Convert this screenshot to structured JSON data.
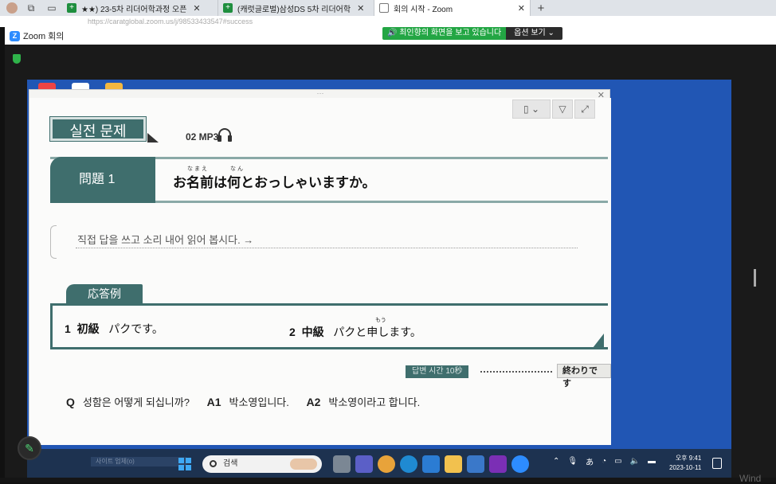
{
  "browser": {
    "tabs": [
      {
        "label": "★★) 23-5차 리더어학과정 오픈",
        "icon": "sheets-icon"
      },
      {
        "label": "(캐럿글로벌)삼성DS 5차 리더어학",
        "icon": "sheets-icon"
      },
      {
        "label": "회의 시작 - Zoom",
        "icon": "doc-icon",
        "active": true
      }
    ],
    "new_tab": "+",
    "close": "✕",
    "url": "https://caratglobal.zoom.us/j/98533433547#success"
  },
  "zoom": {
    "title": "Zoom 회의",
    "share_status": "최인향의 화면을 보고 있습니다",
    "view_options": "옵션 보기"
  },
  "viewer": {
    "drag_handle": "···",
    "close": "✕",
    "page": {
      "practice_tag": "실전 문제",
      "mp3": "02 MP3",
      "problem_label": "問題 1",
      "question_ruby": "なまえ　　　なん",
      "question": "お名前は何とおっしゃいますか。",
      "instruction": "직접 답을 쓰고 소리 내어 읽어 봅시다. →",
      "response_tag": "応答例",
      "resp1_num": "1",
      "resp1_level": "初級",
      "resp1_text": "パクです。",
      "resp2_num": "2",
      "resp2_level": "中級",
      "resp2_ruby": "もう",
      "resp2_text": "パクと申します。",
      "time_label": "답변 시간 10秒",
      "end_label": "終わりです",
      "qa": {
        "q_label": "Q",
        "q_text": "성함은 어떻게 되십니까?",
        "a1_label": "A1",
        "a1_text": "박소영입니다.",
        "a2_label": "A2",
        "a2_text": "박소영이라고 합니다."
      }
    }
  },
  "taskbar": {
    "search_placeholder": "검색",
    "ghost_text": "사이트 업체(o)",
    "time": "오후 9:41",
    "date": "2023-10-11",
    "ime": "あ"
  },
  "windows_ghost": "Wind"
}
